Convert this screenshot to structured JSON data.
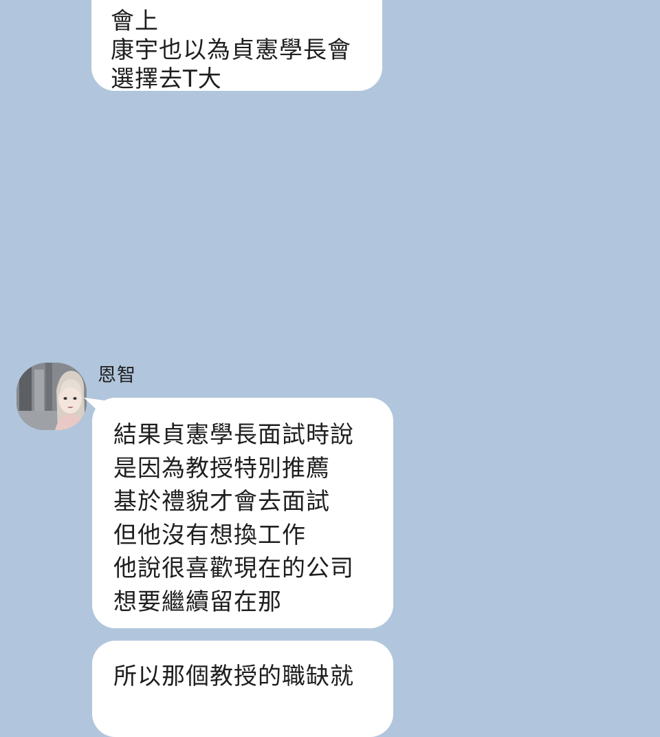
{
  "chat": {
    "messages": [
      {
        "lines": [
          "會上",
          "康宇也以為貞憲學長會",
          "選擇去T大"
        ]
      },
      {
        "sender": "恩智",
        "lines": [
          "結果貞憲學長面試時說",
          "是因為教授特別推薦",
          "基於禮貌才會去面試",
          "但他沒有想換工作",
          "他說很喜歡現在的公司",
          "想要繼續留在那"
        ]
      },
      {
        "lines": [
          "所以那個教授的職缺就"
        ]
      }
    ]
  },
  "colors": {
    "background": "#b1c6dc",
    "bubble": "#ffffff",
    "text": "#1e1e1e"
  },
  "icons": {
    "avatar": "contact-avatar-photo"
  }
}
